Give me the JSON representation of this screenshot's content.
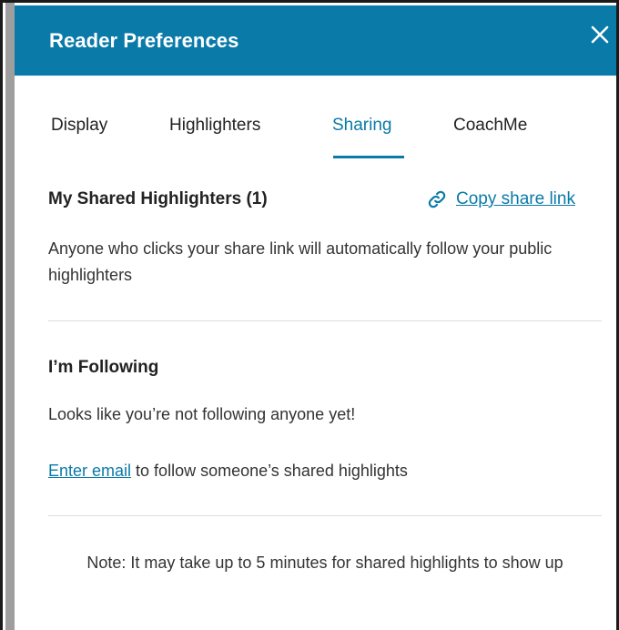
{
  "header": {
    "title": "Reader Preferences",
    "close_icon": "close-icon"
  },
  "tabs": [
    {
      "label": "Display",
      "active": false
    },
    {
      "label": "Highlighters",
      "active": false
    },
    {
      "label": "Sharing",
      "active": true
    },
    {
      "label": "CoachMe",
      "active": false
    }
  ],
  "shared": {
    "title": "My Shared Highlighters (1)",
    "copy_link_label": "Copy share link",
    "copy_link_icon": "link-icon",
    "description": "Anyone who clicks your share link will automatically follow your public highlighters"
  },
  "following": {
    "title": "I’m Following",
    "empty_text": "Looks like you’re not following anyone yet!",
    "enter_email_label": "Enter email",
    "enter_email_suffix": " to follow someone’s shared highlights"
  },
  "note": "Note: It may take up to 5 minutes for shared highlights to show up",
  "colors": {
    "accent": "#0a7aa8",
    "header_bg": "#0a7aa8",
    "divider": "#dcdcdc"
  }
}
